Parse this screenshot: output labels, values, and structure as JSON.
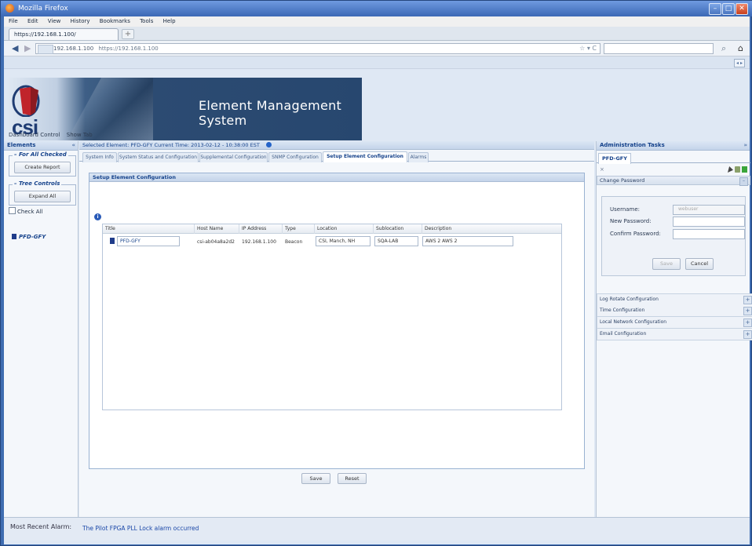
{
  "window": {
    "title": "Mozilla Firefox",
    "min": "–",
    "max": "□",
    "close": "✕"
  },
  "menubar": [
    "File",
    "Edit",
    "View",
    "History",
    "Bookmarks",
    "Tools",
    "Help"
  ],
  "browser": {
    "tab_title": "https://192.168.1.100/",
    "new_tab": "+",
    "back": "◀",
    "forward": "▶",
    "url_site": "192.168.1.100",
    "url": "https://192.168.1.100",
    "url_icons": "☆ ▾ C",
    "search_icon": "⌕",
    "home_icon": "⌂"
  },
  "banner": {
    "logo_text": "csi",
    "title": "Element Management System"
  },
  "ems_tabs": [
    "Dashboard Control",
    "Show Tab"
  ],
  "left_panel": {
    "title": "Elements",
    "for_all_checked": "For All Checked",
    "create_report": "Create Report",
    "tree_controls": "Tree Controls",
    "expand_all": "Expand All",
    "check_all": "Check All",
    "tree_node": "PFD-GFY"
  },
  "center": {
    "selected_text": "Selected Element: PFD-GFY  Current Time: 2013-02-12 - 10:38:00 EST",
    "tabs": [
      "System Info",
      "System Status and Configuration",
      "Supplemental Configuration",
      "SNMP Configuration",
      "Setup Element Configuration",
      "Alarms"
    ],
    "active_tab_index": 4,
    "panel_title": "Setup Element Configuration",
    "grid_headers": [
      "Title",
      "Host Name",
      "IP Address",
      "Type",
      "Location",
      "Sublocation",
      "Description"
    ],
    "row": {
      "title": "PFD-GFY",
      "host": "csi-ab04a8a2d2",
      "ip": "192.168.1.100",
      "type": "Beacon",
      "location": "CSI, Manch, NH",
      "sublocation": "SQA-LAB",
      "description": "AWS 2  AWS 2"
    },
    "save": "Save",
    "reset": "Reset"
  },
  "right_panel": {
    "title": "Administration Tasks",
    "tab": "PFD-GFY",
    "change_password": "Change Password",
    "username_label": "Username:",
    "username_value": "webuser",
    "new_password_label": "New Password:",
    "confirm_password_label": "Confirm Password:",
    "save": "Save",
    "cancel": "Cancel",
    "sections": [
      "Log Rotate Configuration",
      "Time Configuration",
      "Local Network Configuration",
      "Email Configuration"
    ]
  },
  "footer": {
    "label": "Most Recent Alarm:",
    "message": "The Pilot FPGA PLL Lock alarm occurred"
  },
  "colors": {
    "accent": "#15428b",
    "link": "#1a47a8",
    "frame": "#3f6db1"
  }
}
